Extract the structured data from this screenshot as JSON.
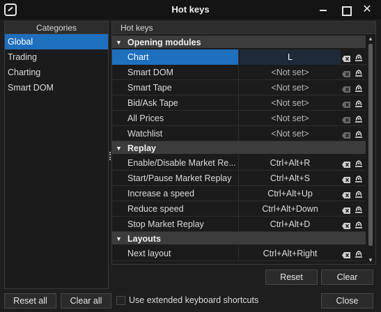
{
  "window": {
    "title": "Hot keys"
  },
  "categories": {
    "header": "Categories",
    "items": [
      "Global",
      "Trading",
      "Charting",
      "Smart DOM"
    ],
    "selected_index": 0
  },
  "hotkeys": {
    "header": "Hot keys",
    "groups": [
      {
        "title": "Opening modules",
        "rows": [
          {
            "name": "Chart",
            "key": "L"
          },
          {
            "name": "Smart DOM",
            "key": "<Not set>"
          },
          {
            "name": "Smart Tape",
            "key": "<Not set>"
          },
          {
            "name": "Bid/Ask Tape",
            "key": "<Not set>"
          },
          {
            "name": "All Prices",
            "key": "<Not set>"
          },
          {
            "name": "Watchlist",
            "key": "<Not set>"
          }
        ]
      },
      {
        "title": "Replay",
        "rows": [
          {
            "name": "Enable/Disable Market Re...",
            "key": "Ctrl+Alt+R"
          },
          {
            "name": "Start/Pause Market Replay",
            "key": "Ctrl+Alt+S"
          },
          {
            "name": "Increase a speed",
            "key": "Ctrl+Alt+Up"
          },
          {
            "name": "Reduce speed",
            "key": "Ctrl+Alt+Down"
          },
          {
            "name": "Stop Market Replay",
            "key": "Ctrl+Alt+D"
          }
        ]
      },
      {
        "title": "Layouts",
        "rows": [
          {
            "name": "Next layout",
            "key": "Ctrl+Alt+Right"
          }
        ]
      }
    ],
    "selected_row": "Chart"
  },
  "buttons": {
    "reset": "Reset",
    "clear": "Clear",
    "reset_all": "Reset all",
    "clear_all": "Clear all",
    "close": "Close"
  },
  "options": {
    "extended_shortcuts_label": "Use extended keyboard shortcuts",
    "extended_shortcuts_checked": false
  },
  "colors": {
    "selection": "#1f6fbf",
    "background": "#1e1e1e",
    "group_header": "#3c3c3c"
  },
  "icons": {
    "clear": "backspace-clear-icon",
    "record": "record-key-icon",
    "collapse": "chevron-down-icon"
  }
}
